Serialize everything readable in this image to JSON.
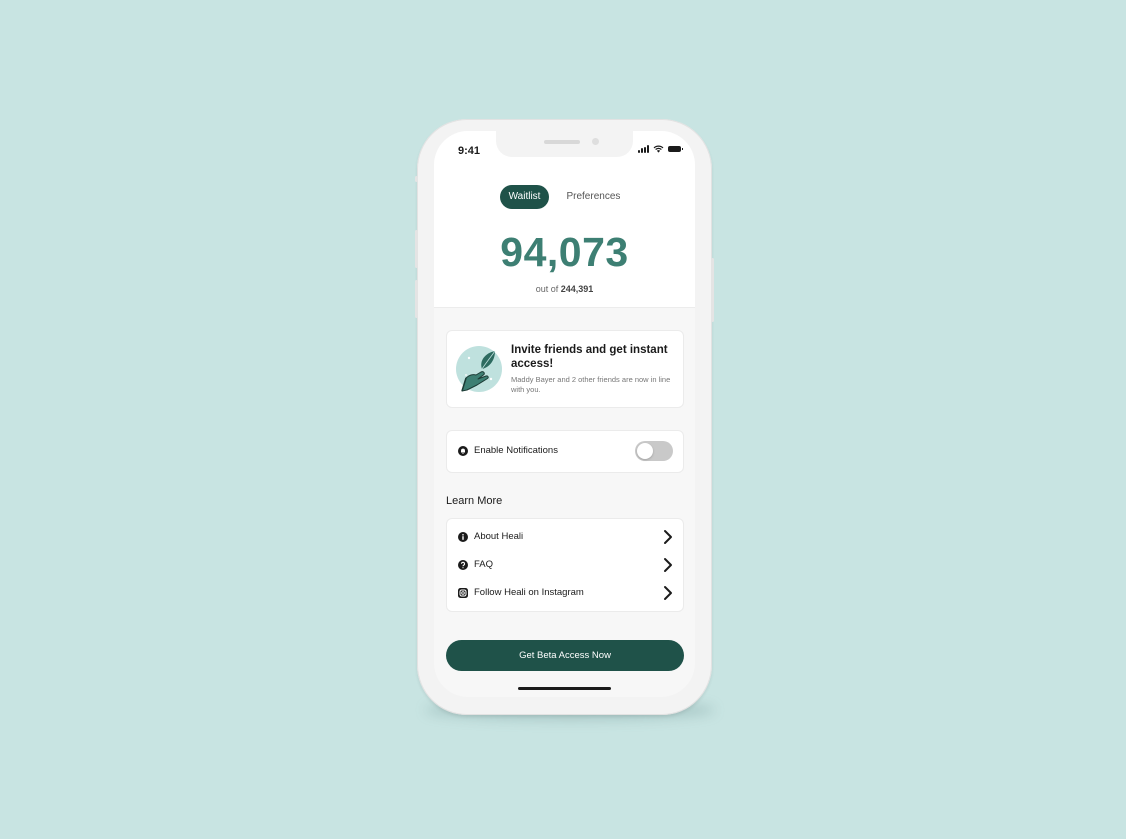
{
  "status_bar": {
    "time": "9:41"
  },
  "tabs": [
    {
      "label": "Waitlist",
      "active": true
    },
    {
      "label": "Preferences",
      "active": false
    }
  ],
  "waitlist": {
    "position": "94,073",
    "out_of_prefix": "out of",
    "total": "244,391"
  },
  "invite": {
    "title": "Invite friends and get instant access!",
    "subtitle": "Maddy Bayer and 2 other friends are now in line with you.",
    "icon": "hand-holding-leaf-illustration"
  },
  "notifications": {
    "label": "Enable Notifications",
    "enabled": false,
    "icon": "bell-icon"
  },
  "learn_more": {
    "title": "Learn More",
    "items": [
      {
        "label": "About Heali",
        "icon": "info-icon"
      },
      {
        "label": "FAQ",
        "icon": "question-icon"
      },
      {
        "label": "Follow Heali on Instagram",
        "icon": "instagram-icon"
      }
    ]
  },
  "cta": {
    "label": "Get Beta Access Now"
  },
  "colors": {
    "background": "#c8e4e2",
    "brand_dark": "#1f5249",
    "brand_count": "#3d7f73",
    "toggle_off": "#c9c9c9"
  }
}
